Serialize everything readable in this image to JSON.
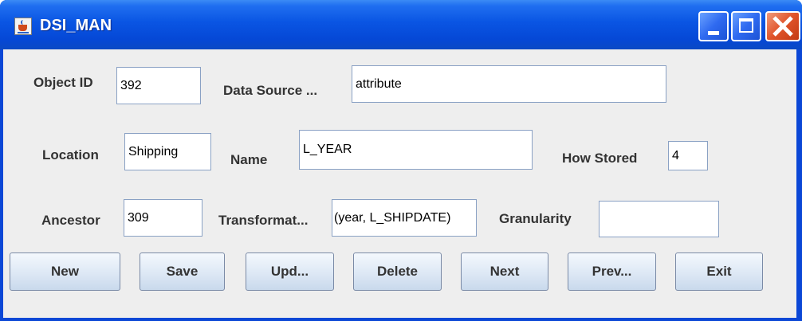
{
  "window": {
    "title": "DSI_MAN",
    "controls": {
      "minimize": "minimize-icon",
      "maximize": "maximize-icon",
      "close": "close-icon"
    }
  },
  "form": {
    "object_id": {
      "label": "Object ID",
      "value": "392"
    },
    "data_source": {
      "label": "Data Source ...",
      "value": "attribute"
    },
    "location": {
      "label": "Location",
      "value": "Shipping"
    },
    "name": {
      "label": "Name",
      "value": "L_YEAR"
    },
    "how_stored": {
      "label": "How Stored",
      "value": "4"
    },
    "ancestor": {
      "label": "Ancestor",
      "value": "309"
    },
    "transformation": {
      "label": "Transformat...",
      "value": "(year, L_SHIPDATE)"
    },
    "granularity": {
      "label": "Granularity",
      "value": ""
    }
  },
  "buttons": {
    "new": "New",
    "save": "Save",
    "update": "Upd...",
    "delete": "Delete",
    "next": "Next",
    "previous": "Prev...",
    "exit": "Exit"
  },
  "colors": {
    "titlebar": "#0548d6",
    "panel": "#eeeeee",
    "close_button": "#e0542a"
  }
}
